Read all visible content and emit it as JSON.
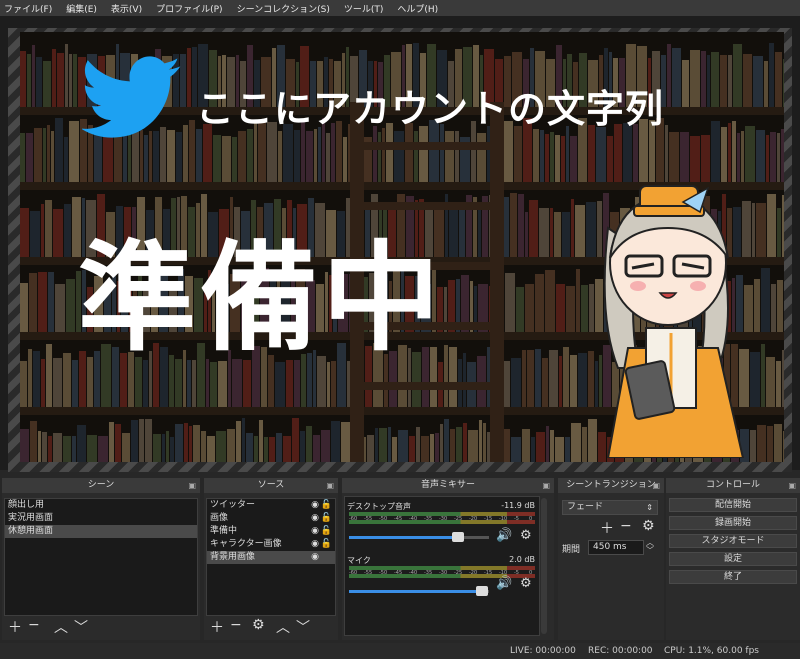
{
  "menu": [
    "ファイル(F)",
    "編集(E)",
    "表示(V)",
    "プロファイル(P)",
    "シーンコレクション(S)",
    "ツール(T)",
    "ヘルプ(H)"
  ],
  "preview": {
    "twitter_text": "ここにアカウントの文字列",
    "big_text": "準備中",
    "icon": "twitter-bird-icon"
  },
  "scenes": {
    "title": "シーン",
    "items": [
      "顔出し用",
      "実況用画面",
      "休憩用画面"
    ],
    "selected": 2
  },
  "sources": {
    "title": "ソース",
    "items": [
      "ツイッター",
      "画像",
      "準備中",
      "キャラクター画像",
      "背景用画像"
    ],
    "selected": 4
  },
  "mixer": {
    "title": "音声ミキサー",
    "channels": [
      {
        "name": "デスクトップ音声",
        "db": "-11.9 dB",
        "level": 0.78
      },
      {
        "name": "マイク",
        "db": "2.0 dB",
        "level": 0.95
      }
    ],
    "ticks": [
      "-60",
      "-55",
      "-50",
      "-45",
      "-40",
      "-35",
      "-30",
      "-25",
      "-20",
      "-15",
      "-10",
      "-5",
      "0"
    ]
  },
  "transitions": {
    "title": "シーントランジション",
    "selected": "フェード",
    "duration_label": "期間",
    "duration_value": "450 ms"
  },
  "controls": {
    "title": "コントロール",
    "buttons": [
      "配信開始",
      "録画開始",
      "スタジオモード",
      "設定",
      "終了"
    ]
  },
  "status": {
    "live": "LIVE: 00:00:00",
    "rec": "REC: 00:00:00",
    "cpu": "CPU: 1.1%, 60.00 fps"
  },
  "colors": {
    "accent": "#1da1f2",
    "orange": "#f2a233",
    "meter_green": "#4caf50",
    "meter_yellow": "#c8b632",
    "meter_red": "#c0392b",
    "slider": "#3a8ee6"
  }
}
